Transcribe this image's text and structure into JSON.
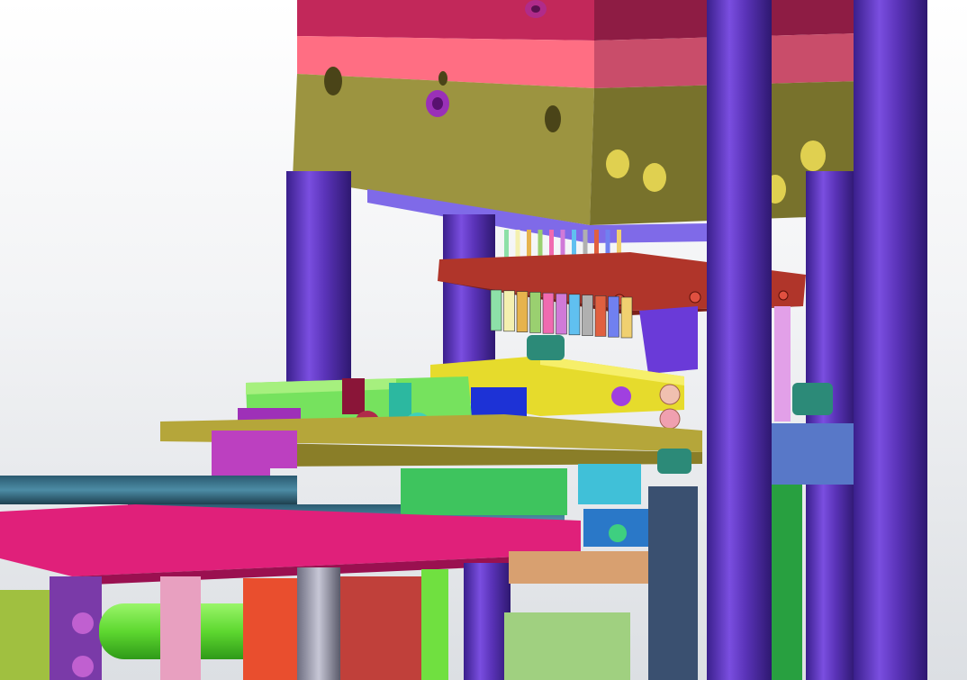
{
  "viewport": {
    "kind": "cad-3d-assembly-view",
    "background_top": "#ffffff",
    "background_bottom": "#dcdfe3"
  },
  "palette": {
    "top_block": "#c2285a",
    "pink_plate": "#ff6e83",
    "olive_block": "#9c9440",
    "column_purple": "#5a33b8",
    "red_holder": "#b0352a",
    "yellow_slide": "#e6db2c",
    "green_block": "#76e25e",
    "magenta_rail": "#e0207a",
    "olive_plate": "#b5a63a",
    "blue_cylinder": "#1d32d6",
    "teal_bolt": "#2c8a78",
    "light_green": "#7ef04a",
    "orange_red": "#e94e2e"
  },
  "pins": {
    "colors": [
      "#8de0a8",
      "#f4f0b0",
      "#e6b34d",
      "#9ad070",
      "#f06ab0",
      "#d07ad8",
      "#60c0f0",
      "#b0b0b0",
      "#e06040",
      "#7080f0",
      "#f0d070"
    ]
  },
  "icons": {
    "socket_screw": "socket-head-cap-screw",
    "fitting": "pneumatic-elbow-fitting",
    "hole": "counterbored-hole"
  }
}
